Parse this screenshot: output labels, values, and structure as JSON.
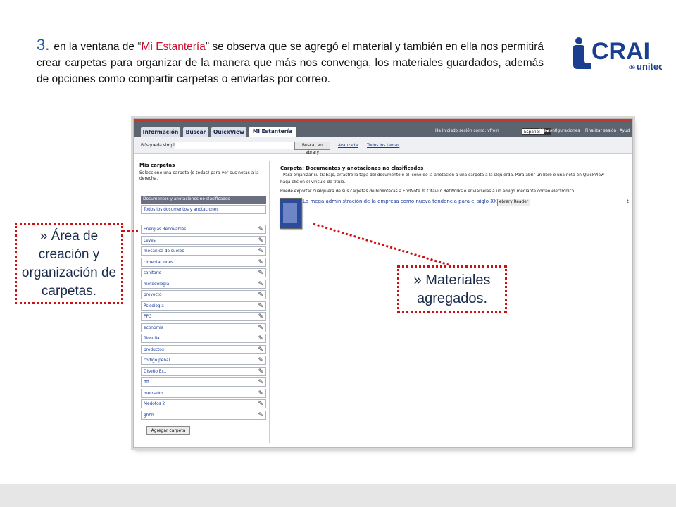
{
  "intro": {
    "step_number": "3.",
    "text_before": "en la ventana de “",
    "highlight": "Mi Estantería",
    "text_after": "” se observa que se agregó el material y también en ella nos permitirá crear carpetas para organizar de la manera que  más nos convenga, los materiales guardados, además de opciones como compartir carpetas  o enviarlas por correo."
  },
  "logo": {
    "main": "CRAI",
    "sub_de": "de",
    "sub_brand": "unitec"
  },
  "ebrary": {
    "tabs": [
      "Información",
      "Buscar",
      "QuickView",
      "Mi Estantería"
    ],
    "header": {
      "session_label": "Ha iniciado sesión como: vfrein",
      "language": "Español",
      "links": [
        "Mis configuraciones",
        "Finalizar sesión",
        "Ayud"
      ]
    },
    "search": {
      "label": "Búsqueda simple:",
      "value": "",
      "button": "Buscar en ebrary",
      "advanced": "Avanzada",
      "all_topics": "Todos los temas"
    },
    "left": {
      "title": "Mis carpetas",
      "subtitle": "Seleccione una carpeta (o todas) para ver sus notas a la derecha.",
      "unclassified": "Documentos y anotaciones no clasificados",
      "all": "Todos los documentos y anotaciones",
      "folders": [
        "Energías Renovables",
        "Leyes",
        "mecanica de suelos",
        "cimentaciones",
        "sanitario",
        "metodologia",
        "proyecto",
        "Psicologia",
        "PPG",
        "economia",
        "filosofia",
        "productos",
        "codigo penal",
        "Diseño Ex..",
        "ffff",
        "mercados",
        "Medotos 2",
        "ghhh"
      ],
      "add_button": "Agregar carpeta"
    },
    "right": {
      "title": "Carpeta: Documentos y anotaciones no clasificados",
      "line1": "Para organizar su trabajo, arrastre la tapa del documento o el icono de la anotación a una carpeta a la izquierda. Para abrir un libro o una nota en QuickView",
      "line2": "haga clic en el vínculo de título.",
      "export_text": "Puede exportar cualquiera de sus carpetas de bibliotecas a EndNote ® Citavi o RefWorks o enviarselas a un amigo mediante correo electrónico.",
      "result_title": "La mega administración de la empresa como nueva tendencia para el siglo XXI",
      "reader_button": "ebrary Reader",
      "trailing": "t"
    }
  },
  "callouts": {
    "left": "» Área de creación y organización de carpetas.",
    "right": "» Materiales agregados."
  },
  "colors": {
    "accent_red": "#d01010",
    "step_blue": "#1e5aa8",
    "logo_blue": "#1b3f8f"
  }
}
